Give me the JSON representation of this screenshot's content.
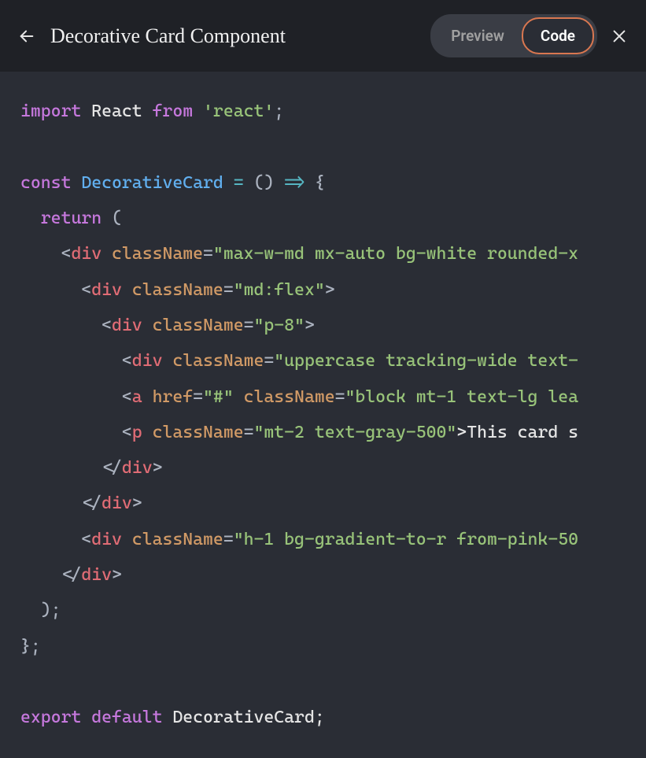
{
  "header": {
    "title": "Decorative Card Component",
    "tabs": {
      "preview": "Preview",
      "code": "Code"
    }
  },
  "code": {
    "l1": {
      "t1": "import",
      "t2": " React ",
      "t3": "from",
      "t4": " ",
      "t5": "'react'",
      "t6": ";"
    },
    "l2": "",
    "l3": {
      "t1": "const",
      "t2": " ",
      "t3": "DecorativeCard",
      "t4": " ",
      "t5": "=",
      "t6": " () ",
      "t7": "=>",
      "t8": " {"
    },
    "l4": {
      "t1": "  ",
      "t2": "return",
      "t3": " ("
    },
    "l5": {
      "t1": "    <",
      "t2": "div",
      "t3": " ",
      "t4": "className",
      "t5": "=",
      "t6": "\"max-w-md mx-auto bg-white rounded-x"
    },
    "l6": {
      "t1": "      <",
      "t2": "div",
      "t3": " ",
      "t4": "className",
      "t5": "=",
      "t6": "\"md:flex\"",
      "t7": ">"
    },
    "l7": {
      "t1": "        <",
      "t2": "div",
      "t3": " ",
      "t4": "className",
      "t5": "=",
      "t6": "\"p-8\"",
      "t7": ">"
    },
    "l8": {
      "t1": "          <",
      "t2": "div",
      "t3": " ",
      "t4": "className",
      "t5": "=",
      "t6": "\"uppercase tracking-wide text-"
    },
    "l9": {
      "t1": "          <",
      "t2": "a",
      "t3": " ",
      "t4": "href",
      "t5": "=",
      "t6": "\"#\"",
      "t7": " ",
      "t8": "className",
      "t9": "=",
      "t10": "\"block mt-1 text-lg lea"
    },
    "l10": {
      "t1": "          <",
      "t2": "p",
      "t3": " ",
      "t4": "className",
      "t5": "=",
      "t6": "\"mt-2 text-gray-500\"",
      "t7": ">This card s"
    },
    "l11": {
      "t1": "        </",
      "t2": "div",
      "t3": ">"
    },
    "l12": {
      "t1": "      </",
      "t2": "div",
      "t3": ">"
    },
    "l13": {
      "t1": "      <",
      "t2": "div",
      "t3": " ",
      "t4": "className",
      "t5": "=",
      "t6": "\"h-1 bg-gradient-to-r from-pink-50"
    },
    "l14": {
      "t1": "    </",
      "t2": "div",
      "t3": ">"
    },
    "l15": {
      "t1": "  );"
    },
    "l16": {
      "t1": "};"
    },
    "l17": "",
    "l18": {
      "t1": "export",
      "t2": " ",
      "t3": "default",
      "t4": " DecorativeCard;"
    }
  }
}
